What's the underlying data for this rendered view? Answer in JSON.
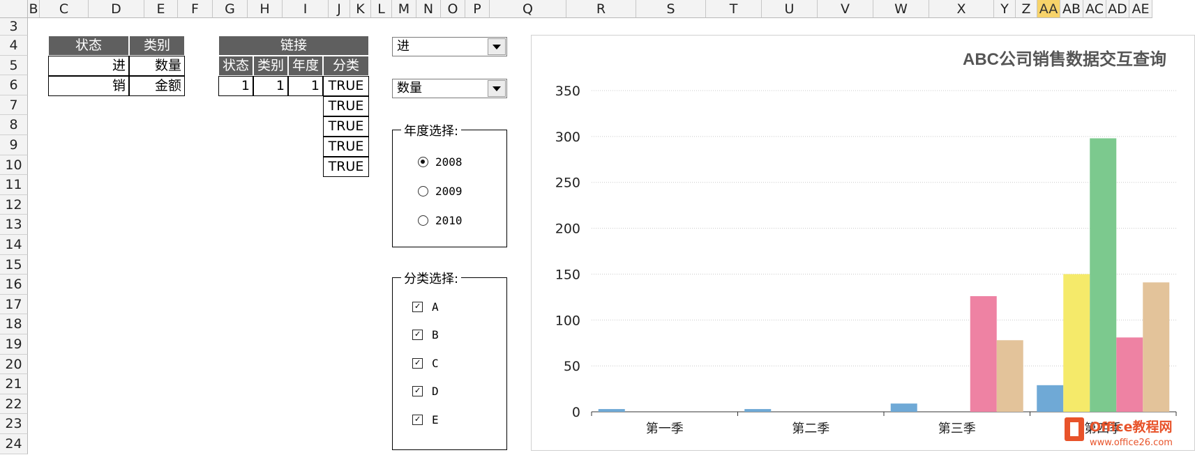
{
  "columns": [
    "B",
    "C",
    "D",
    "E",
    "F",
    "G",
    "H",
    "I",
    "J",
    "K",
    "L",
    "M",
    "N",
    "O",
    "P",
    "Q",
    "R",
    "S",
    "T",
    "U",
    "V",
    "W",
    "X",
    "Y",
    "Z",
    "AA",
    "AB",
    "AC",
    "AD",
    "AE"
  ],
  "selected_column": "AA",
  "rows": [
    "3",
    "4",
    "5",
    "6",
    "7",
    "8",
    "9",
    "10",
    "11",
    "12",
    "13",
    "14",
    "15",
    "16",
    "17",
    "18",
    "19",
    "20",
    "21",
    "22",
    "23",
    "24"
  ],
  "table1": {
    "h_status": "状态",
    "h_type": "类别",
    "r1_status": "进",
    "r1_type": "数量",
    "r2_status": "销",
    "r2_type": "金额"
  },
  "table2": {
    "title": "链接",
    "h_status": "状态",
    "h_type": "类别",
    "h_year": "年度",
    "h_cat": "分类",
    "v_status": "1",
    "v_type": "1",
    "v_year": "1",
    "cat_values": [
      "TRUE",
      "TRUE",
      "TRUE",
      "TRUE",
      "TRUE"
    ]
  },
  "combo_status": "进",
  "combo_type": "数量",
  "year_group": {
    "label": "年度选择:",
    "options": [
      "2008",
      "2009",
      "2010"
    ],
    "selected": "2008"
  },
  "cat_group": {
    "label": "分类选择:",
    "options": [
      "A",
      "B",
      "C",
      "D",
      "E"
    ],
    "checked": [
      "A",
      "B",
      "C",
      "D",
      "E"
    ]
  },
  "colors": {
    "A": "#6fa9d6",
    "B": "#f5ea6a",
    "C": "#7cc98e",
    "D": "#ee82a3",
    "E": "#e3c39a",
    "header": "#5f5f5f",
    "selected_col": "#f7d36a"
  },
  "chart_data": {
    "type": "bar",
    "title": "ABC公司销售数据交互查询",
    "categories": [
      "第一季",
      "第二季",
      "第三季",
      "第四季"
    ],
    "series": [
      {
        "name": "A",
        "values": [
          3,
          3,
          9,
          29
        ]
      },
      {
        "name": "B",
        "values": [
          0,
          0,
          0,
          150
        ]
      },
      {
        "name": "C",
        "values": [
          0,
          0,
          0,
          298
        ]
      },
      {
        "name": "D",
        "values": [
          0,
          0,
          126,
          81
        ]
      },
      {
        "name": "E",
        "values": [
          0,
          0,
          78,
          141
        ]
      }
    ],
    "yticks": [
      "0",
      "50",
      "100",
      "150",
      "200",
      "250",
      "300",
      "350"
    ],
    "ylim": [
      0,
      350
    ],
    "grid": true
  },
  "watermark": {
    "line1": "Office教程网",
    "line2": "www.office26.com"
  }
}
